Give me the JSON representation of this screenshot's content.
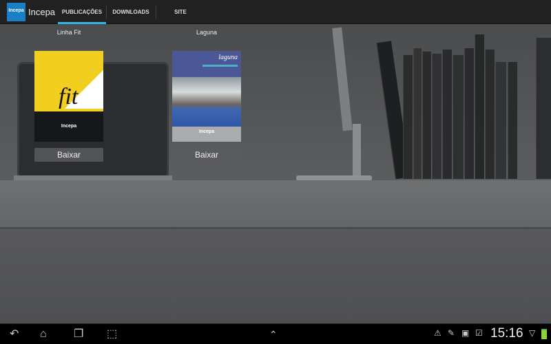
{
  "app": {
    "title": "Incepa",
    "logo_text": "Incepa"
  },
  "tabs": [
    {
      "label": "PUBLICAÇÕES",
      "active": true
    },
    {
      "label": "DOWNLOADS",
      "active": false
    },
    {
      "label": "SITE",
      "active": false
    }
  ],
  "accent": "#33b5e5",
  "publications": [
    {
      "title": "Linha Fit",
      "cover_text": "fit",
      "brand": "Incepa",
      "button": "Baixar"
    },
    {
      "title": "Laguna",
      "cover_text": "laguna",
      "brand": "Incepa",
      "button": "Baixar"
    }
  ],
  "status": {
    "time": "15:16",
    "icons": [
      "warning-icon",
      "pencil-icon",
      "play-store-icon",
      "checklist-icon",
      "wifi-icon",
      "battery-icon"
    ]
  }
}
